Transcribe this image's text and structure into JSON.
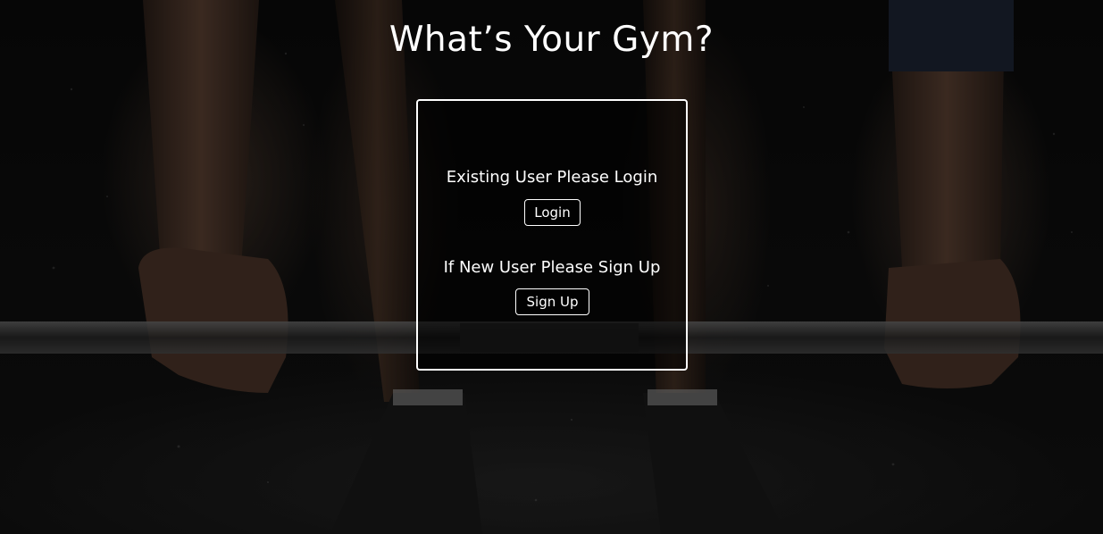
{
  "header": {
    "title": "What’s Your Gym?"
  },
  "auth": {
    "login_prompt": "Existing User Please Login",
    "login_label": "Login",
    "signup_prompt": "If New User Please Sign Up",
    "signup_label": "Sign Up"
  },
  "colors": {
    "text": "#ffffff",
    "background": "#050505",
    "border": "#ffffff"
  }
}
